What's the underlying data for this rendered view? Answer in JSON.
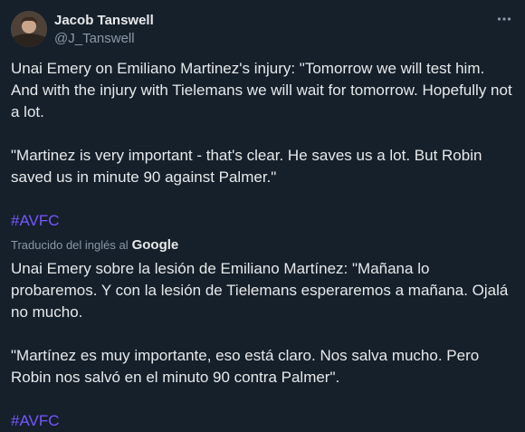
{
  "author": {
    "name": "Jacob Tanswell",
    "handle": "@J_Tanswell",
    "avatar_icon": "user-avatar-icon"
  },
  "menu_icon": "more-horizontal-icon",
  "tweet": {
    "paragraph1": "Unai Emery on Emiliano Martinez's injury: \"Tomorrow we will test him. And with the injury with Tielemans we will wait for tomorrow. Hopefully not a lot.",
    "paragraph2": "\"Martinez is very important - that's clear. He saves us a lot. But Robin saved us in minute 90 against Palmer.\"",
    "hashtag": "#AVFC"
  },
  "translation": {
    "label": "Traducido del inglés al",
    "provider": "Google",
    "paragraph1": "Unai Emery sobre la lesión de Emiliano Martínez: \"Mañana lo probaremos. Y con la lesión de Tielemans esperaremos a mañana. Ojalá no mucho.",
    "paragraph2": "\"Martínez es muy importante, eso está claro. Nos salva mucho. Pero Robin nos salvó en el minuto 90 contra Palmer\".",
    "hashtag": "#AVFC"
  },
  "colors": {
    "background": "#15202b",
    "text": "#e7e9ea",
    "secondary": "#8b98a5",
    "hashtag": "#7856ff"
  }
}
